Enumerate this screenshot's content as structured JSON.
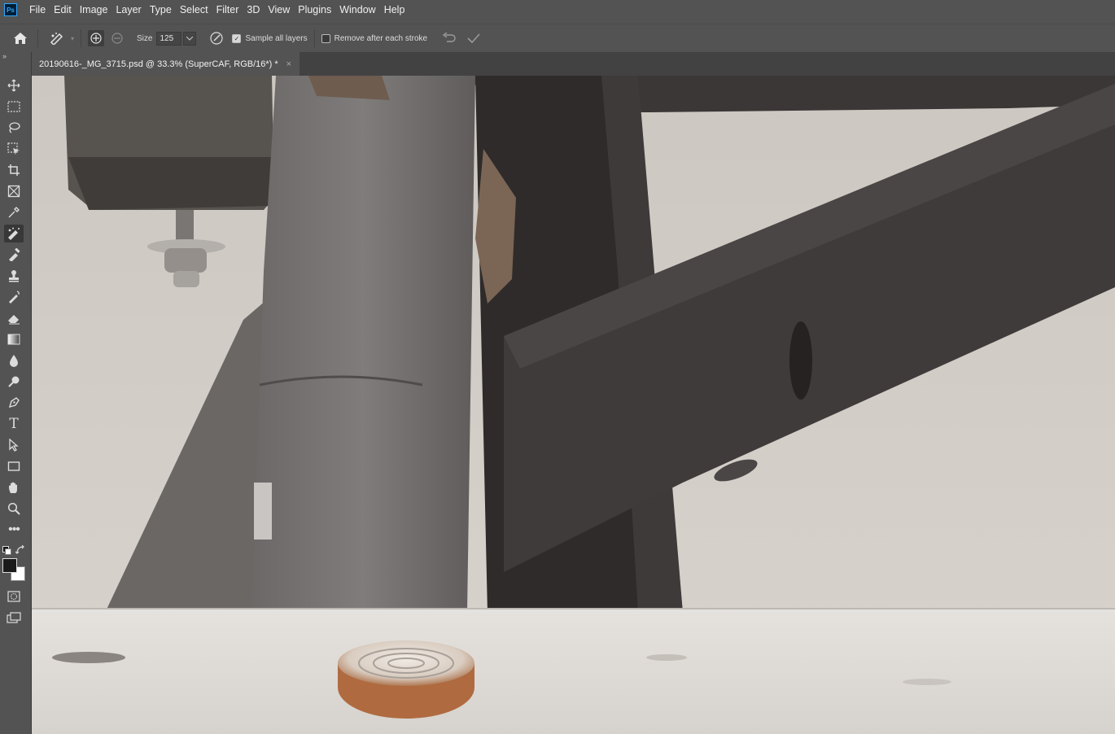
{
  "menubar": {
    "logo": "Ps",
    "items": [
      "File",
      "Edit",
      "Image",
      "Layer",
      "Type",
      "Select",
      "Filter",
      "3D",
      "View",
      "Plugins",
      "Window",
      "Help"
    ]
  },
  "options": {
    "size_label": "Size",
    "size_value": "125",
    "sample_all_layers_label": "Sample all layers",
    "sample_all_layers_checked": true,
    "remove_after_stroke_label": "Remove after each stroke",
    "remove_after_stroke_checked": false
  },
  "document": {
    "tab_title": "20190616-_MG_3715.psd @ 33.3% (SuperCAF, RGB/16*) *",
    "close_glyph": "×"
  },
  "toolbar": {
    "collapse_glyph": "»",
    "tools": [
      "move-tool",
      "marquee-tool",
      "lasso-tool",
      "object-select-tool",
      "crop-tool",
      "frame-tool",
      "eyedropper-tool",
      "remove-tool",
      "healing-brush-tool",
      "clone-stamp-tool",
      "history-brush-tool",
      "eraser-tool",
      "gradient-tool",
      "blur-tool",
      "dodge-tool",
      "pen-tool",
      "type-tool",
      "path-select-tool",
      "rectangle-tool",
      "hand-tool",
      "zoom-tool",
      "more-tools"
    ],
    "foreground_color": "#1b1b1b",
    "background_color": "#ffffff"
  }
}
